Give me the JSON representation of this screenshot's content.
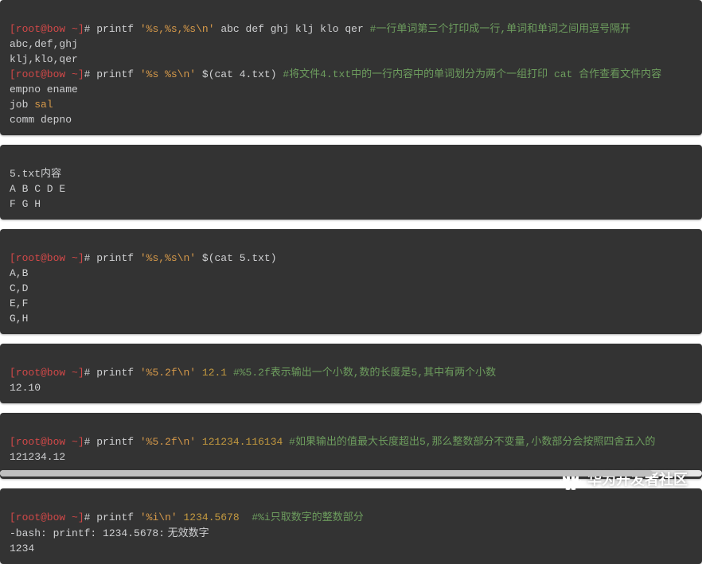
{
  "prompt": "[root@bow ~]",
  "hash": "#",
  "blocks": {
    "b1": {
      "cmd1": {
        "command": "printf",
        "arg": "'%s,%s,%s\\n'",
        "rest": "abc def ghj klj klo qer",
        "comment": "#一行单词第三个打印成一行,单词和单词之间用逗号隔开"
      },
      "out1": "abc,def,ghj\nklj,klo,qer",
      "cmd2": {
        "command": "printf",
        "arg": "'%s %s\\n'",
        "rest": "$(cat 4.txt)",
        "comment": "#将文件4.txt中的一行内容中的单词划分为两个一组打印 cat 合作查看文件内容"
      },
      "out2_line1_a": "empno ename",
      "out2_line2_a": "job ",
      "out2_line2_b": "sal",
      "out2_line3_a": "comm depno"
    },
    "b2": {
      "title": "5.txt内容",
      "line1": "A B C D E",
      "line2": "F G H"
    },
    "b3": {
      "cmd": {
        "command": "printf",
        "arg": "'%s,%s\\n'",
        "rest": "$(cat 5.txt)"
      },
      "out": "A,B\nC,D\nE,F\nG,H"
    },
    "b4": {
      "cmd": {
        "command": "printf",
        "arg": "'%5.2f\\n'",
        "rest": "12.1",
        "comment": "#%5.2f表示输出一个小数,数的长度是5,其中有两个小数"
      },
      "out": "12.10"
    },
    "b5": {
      "cmd": {
        "command": "printf",
        "arg": "'%5.2f\\n'",
        "rest": "121234.116134",
        "comment": "#如果输出的值最大长度超出5,那么整数部分不变量,小数部分会按照四舍五入的"
      },
      "out": "121234.12"
    },
    "b6": {
      "cmd": {
        "command": "printf",
        "arg": "'%i\\n'",
        "rest": "1234.5678 ",
        "comment": " #%i只取数字的整数部分"
      },
      "err_a": "-bash: printf: 1234.5678:",
      "err_b": " 无效数字",
      "out": "1234"
    }
  },
  "watermark": "华为开发者社区"
}
